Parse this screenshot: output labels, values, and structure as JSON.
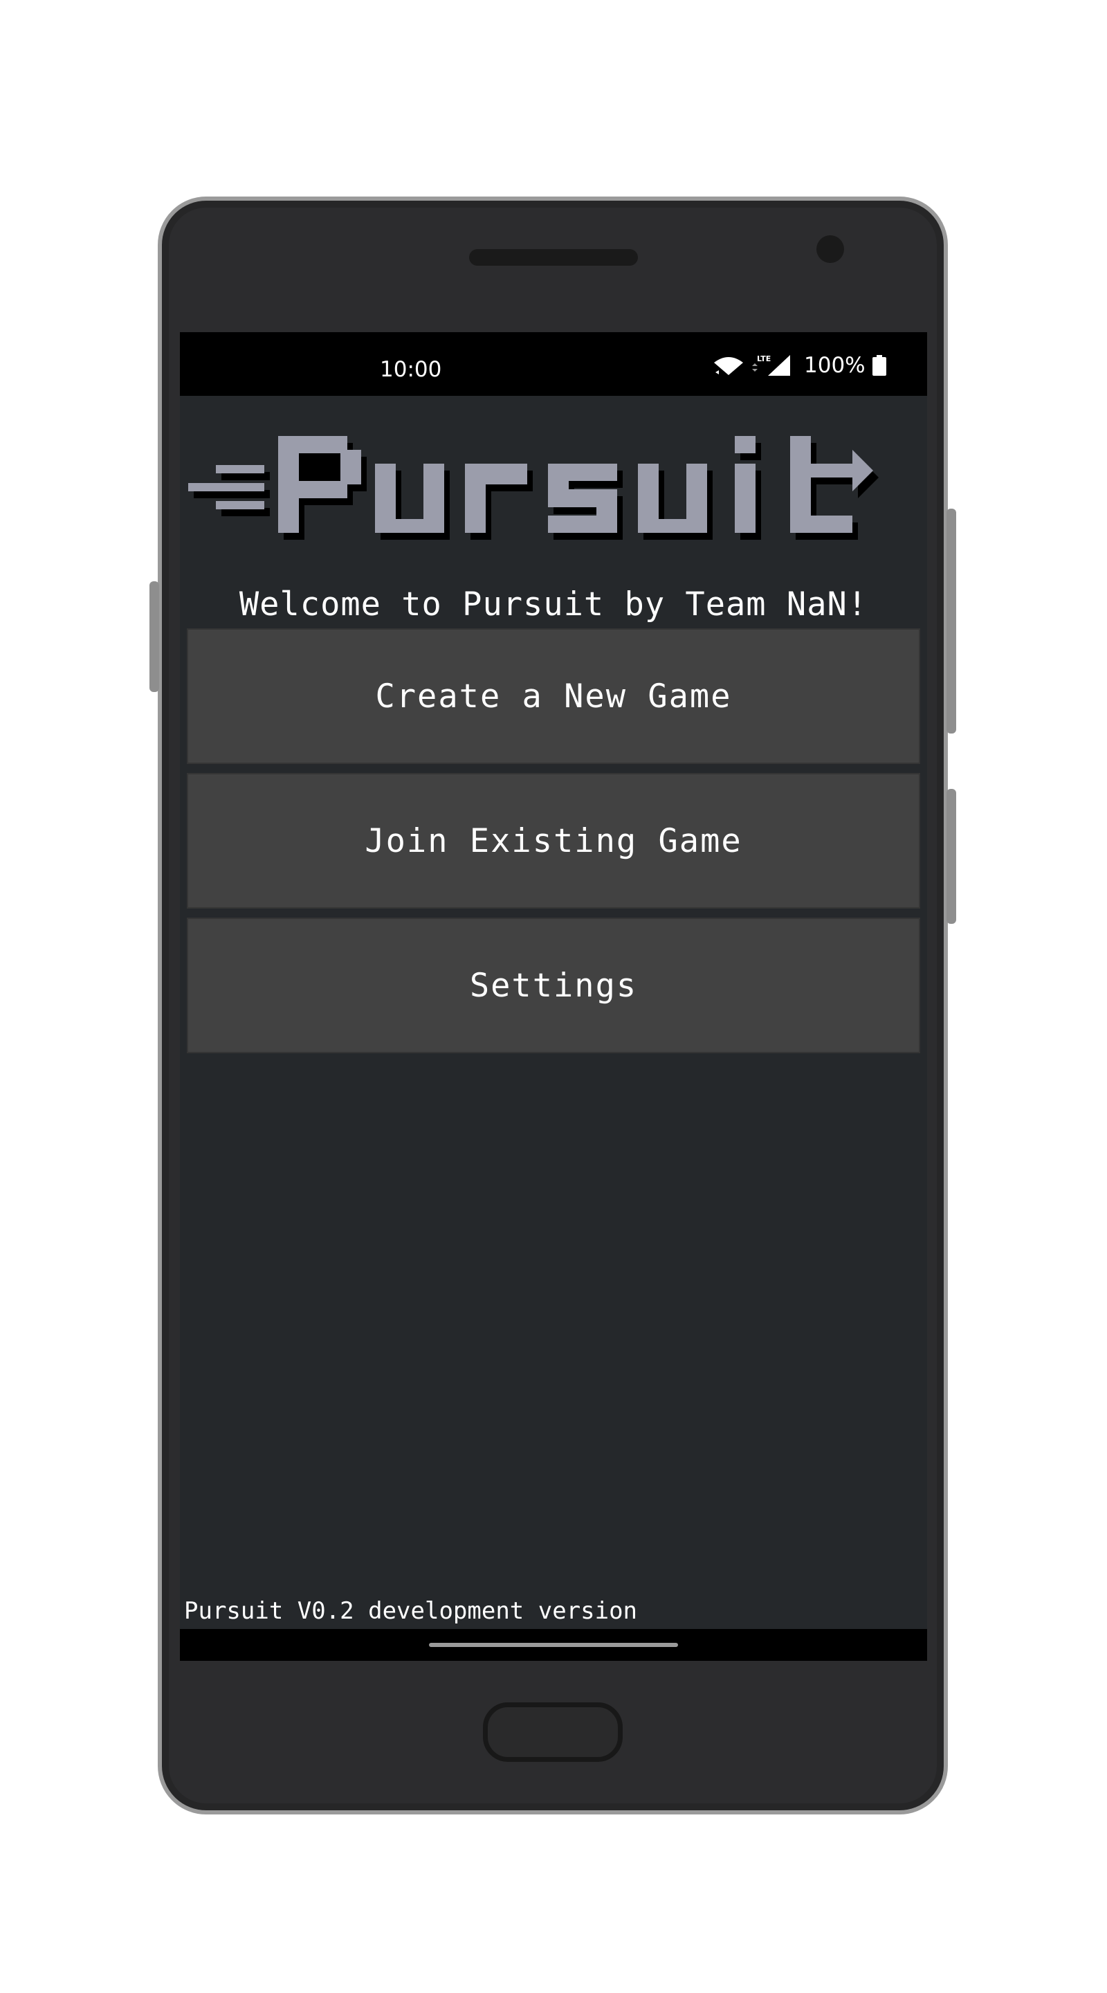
{
  "status_bar": {
    "time": "10:00",
    "network": "LTE",
    "battery": "100%"
  },
  "app": {
    "logo_text": "Pursuit",
    "welcome": "Welcome to Pursuit by Team NaN!",
    "buttons": {
      "create": "Create a New Game",
      "join": "Join Existing Game",
      "settings": "Settings"
    },
    "version": "Pursuit V0.2 development version"
  },
  "icons": [
    "wifi-icon",
    "signal-icon",
    "battery-icon",
    "home-handle"
  ],
  "colors": {
    "screen_bg": "#25282b",
    "button_bg": "#424242",
    "logo": "#9b9dab",
    "text": "#ffffff"
  }
}
